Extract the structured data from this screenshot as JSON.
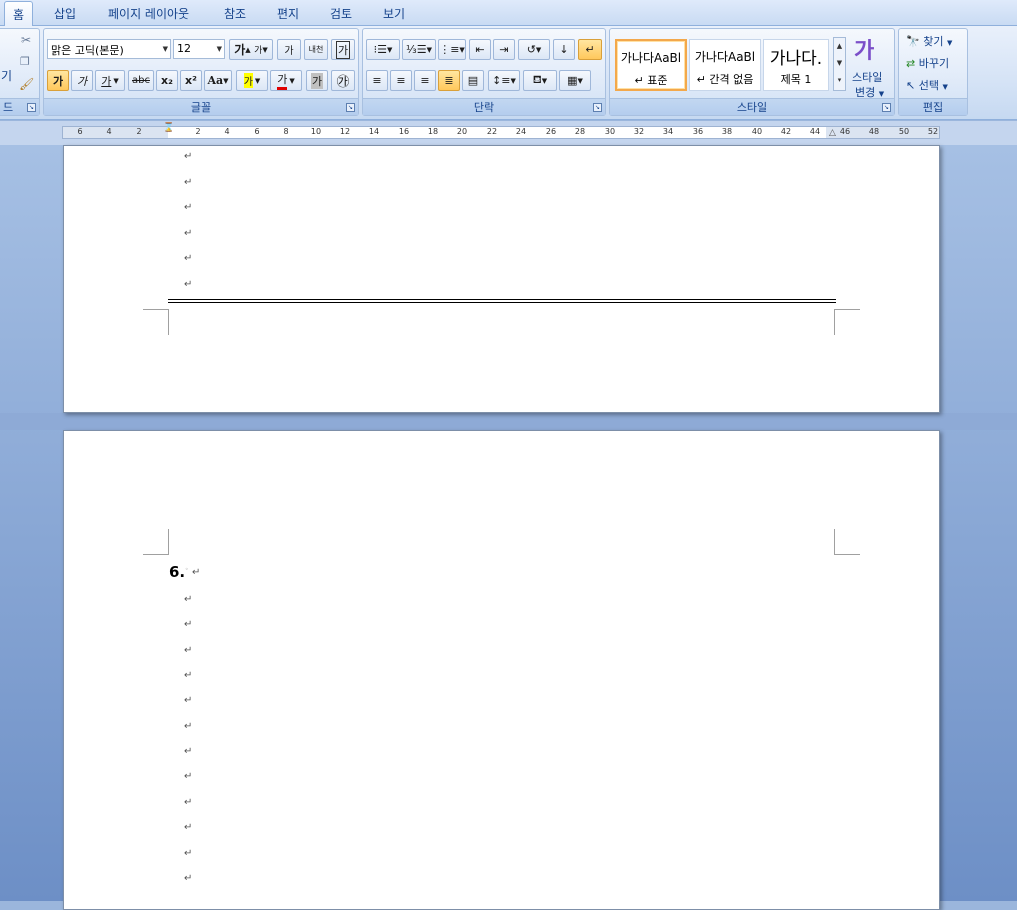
{
  "tabs": [
    "홈",
    "삽입",
    "페이지 레이아웃",
    "참조",
    "편지",
    "검토",
    "보기"
  ],
  "clipboard": {
    "label_partial": "드",
    "paste_partial": "기"
  },
  "font": {
    "group_label": "글꼴",
    "font_name": "맑은 고딕(본문)",
    "font_size": "12",
    "grow_label": "가",
    "shrink_label": "가",
    "clear_label": "가",
    "phonetic_label": "내천",
    "border_label": "가",
    "bold_label": "가",
    "italic_label": "가",
    "underline_label": "가",
    "strike_label": "abc",
    "sub_label": "x₂",
    "sup_label": "x²",
    "case_label": "Aa",
    "highlight_label": "가",
    "color_label": "가",
    "shade_label": "가",
    "enclose_label": "㉮"
  },
  "paragraph": {
    "group_label": "단락"
  },
  "styles": {
    "group_label": "스타일",
    "items": [
      {
        "sample": "가나다AaBl",
        "name": "↵ 표준"
      },
      {
        "sample": "가나다AaBl",
        "name": "↵ 간격 없음"
      },
      {
        "sample": "가나다.",
        "name": "제목 1"
      }
    ],
    "change_label_1": "스타일",
    "change_label_2": "변경"
  },
  "editing": {
    "group_label": "편집",
    "find": "찾기",
    "replace": "바꾸기",
    "select": "선택"
  },
  "ruler": {
    "ticks": [
      "6",
      "4",
      "2",
      "2",
      "4",
      "6",
      "8",
      "10",
      "12",
      "14",
      "16",
      "18",
      "20",
      "22",
      "24",
      "26",
      "28",
      "30",
      "32",
      "34",
      "36",
      "38",
      "40",
      "42",
      "44",
      "46",
      "48",
      "50",
      "52"
    ]
  },
  "document": {
    "para_mark": "↵",
    "item_number": "6.",
    "colors": {
      "accent": "#f3a84b",
      "background": "#9bb6dc"
    }
  }
}
